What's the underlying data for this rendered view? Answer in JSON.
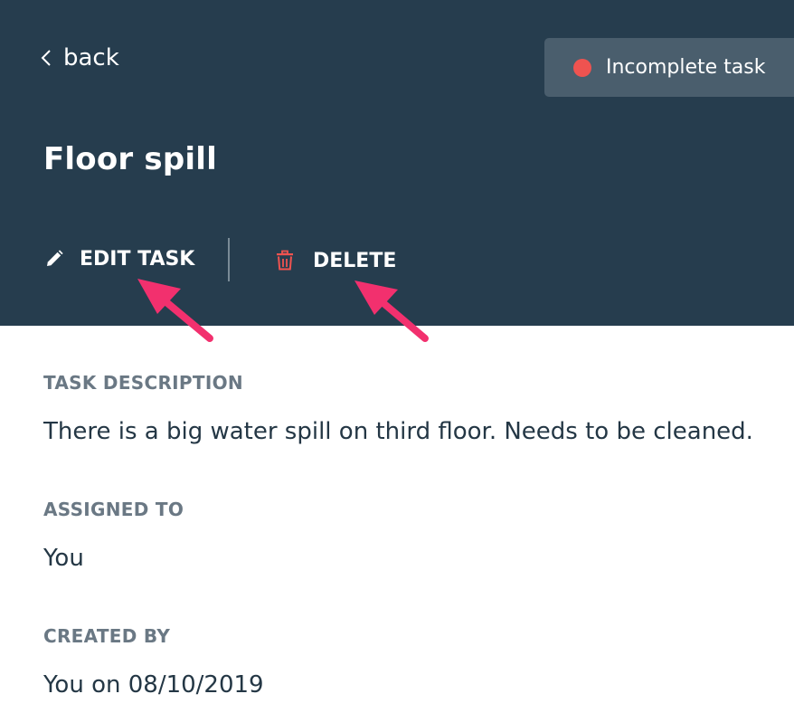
{
  "header": {
    "back_label": "back",
    "status": {
      "label": "Incomplete task",
      "dot_color": "#ef5350"
    },
    "title": "Floor spill",
    "actions": {
      "edit_label": "EDIT TASK",
      "delete_label": "DELETE"
    },
    "colors": {
      "background": "#263d4e",
      "delete_icon": "#ef5350",
      "annotation_arrow": "#f2306e"
    }
  },
  "details": {
    "description": {
      "label": "TASK DESCRIPTION",
      "value": "There is a big water spill on third floor. Needs to be cleaned."
    },
    "assigned_to": {
      "label": "ASSIGNED TO",
      "value": "You"
    },
    "created_by": {
      "label": "CREATED BY",
      "value": "You on 08/10/2019"
    }
  },
  "icons": {
    "back": "chevron-left-icon",
    "status": "status-dot-icon",
    "edit": "pencil-icon",
    "delete": "trash-icon",
    "annotation": "arrow-annotation"
  }
}
